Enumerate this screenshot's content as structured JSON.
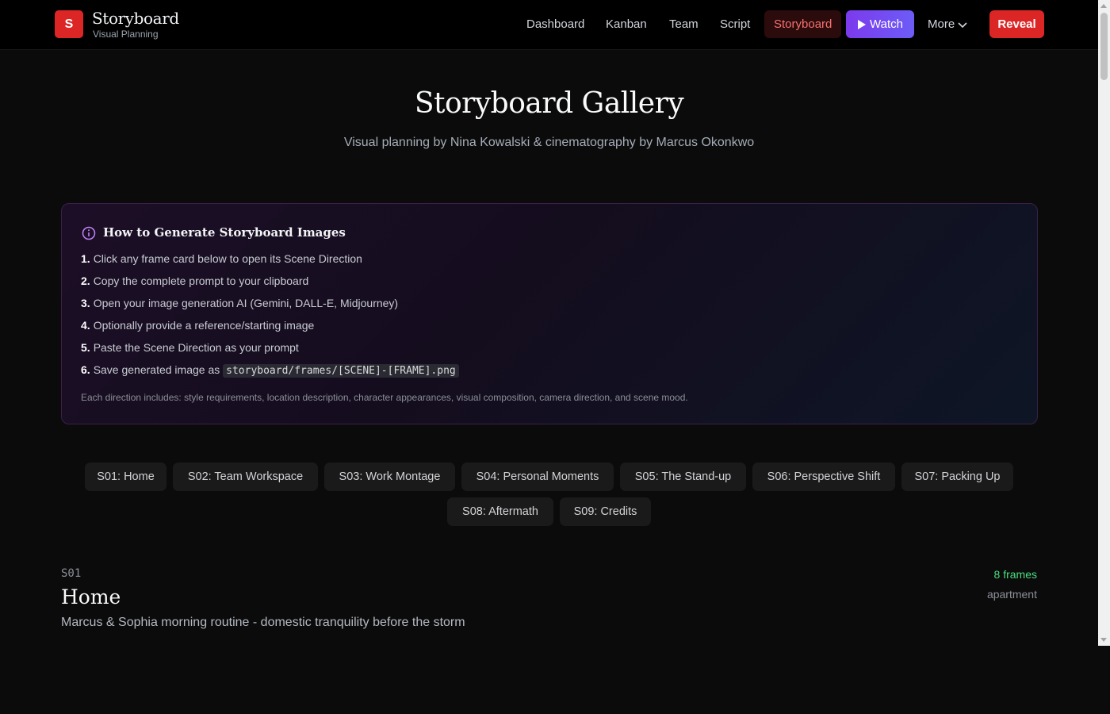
{
  "brand": {
    "badge": "S",
    "title": "Storyboard",
    "subtitle": "Visual Planning"
  },
  "nav": {
    "items": [
      "Dashboard",
      "Kanban",
      "Team",
      "Script",
      "Storyboard"
    ],
    "active": "Storyboard",
    "watch_label": "Watch",
    "more_label": "More",
    "reveal_label": "Reveal"
  },
  "hero": {
    "title": "Storyboard Gallery",
    "subtitle": "Visual planning by Nina Kowalski & cinematography by Marcus Okonkwo"
  },
  "info": {
    "title": "How to Generate Storyboard Images",
    "steps": [
      {
        "num": "1.",
        "text": "Click any frame card below to open its Scene Direction"
      },
      {
        "num": "2.",
        "text": "Copy the complete prompt to your clipboard"
      },
      {
        "num": "3.",
        "text": "Open your image generation AI (Gemini, DALL-E, Midjourney)"
      },
      {
        "num": "4.",
        "text": "Optionally provide a reference/starting image"
      },
      {
        "num": "5.",
        "text": "Paste the Scene Direction as your prompt"
      },
      {
        "num": "6.",
        "text": "Save generated image as",
        "code": "storyboard/frames/[SCENE]-[FRAME].png"
      }
    ],
    "note": "Each direction includes: style requirements, location description, character appearances, visual composition, camera direction, and scene mood."
  },
  "scene_chips": [
    "S01: Home",
    "S02: Team Workspace",
    "S03: Work Montage",
    "S04: Personal Moments",
    "S05: The Stand-up",
    "S06: Perspective Shift",
    "S07: Packing Up",
    "S08: Aftermath",
    "S09: Credits"
  ],
  "scene": {
    "code": "S01",
    "title": "Home",
    "description": "Marcus & Sophia morning routine - domestic tranquility before the storm",
    "frames": "8 frames",
    "location": "apartment"
  },
  "colors": {
    "accent_red": "#dc2626",
    "accent_purple": "#7c3aed",
    "frames_green": "#4ade80"
  }
}
